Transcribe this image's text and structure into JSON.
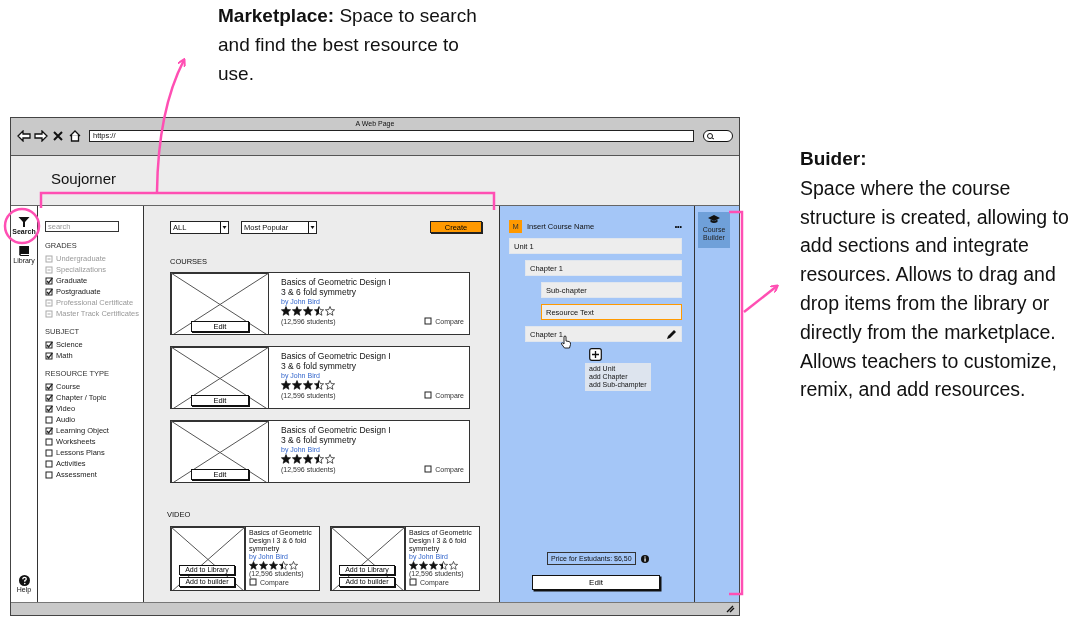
{
  "annotations": {
    "marketplace": {
      "text": "**Marketplace:** Space to search and find the best resource to use."
    },
    "builder": {
      "title": "Buider:",
      "text": "Space where the course structure is created, allowing to add sections and integrate resources. Allows to drag and drop items from the library or directly from the marketplace. Allows teachers to customize, remix, and add resources."
    }
  },
  "browser": {
    "title": "A Web Page",
    "url": "https://"
  },
  "app": {
    "name": "Soujorner"
  },
  "nav": [
    {
      "kind": "filter",
      "label": "Search",
      "selected": true
    },
    {
      "kind": "book",
      "label": "Library",
      "selected": false
    }
  ],
  "help": {
    "label": "Help"
  },
  "filters": {
    "placeholder": "search",
    "groups": [
      {
        "title": "GRADES",
        "items": [
          {
            "label": "Undergraduate",
            "checked": false,
            "disabled": true
          },
          {
            "label": "Specializations",
            "checked": false,
            "disabled": true
          },
          {
            "label": "Graduate",
            "checked": true,
            "disabled": false
          },
          {
            "label": "Postgraduate",
            "checked": true,
            "disabled": false
          },
          {
            "label": "Professional Certificate",
            "checked": false,
            "disabled": true
          },
          {
            "label": "Master Track Certificates",
            "checked": false,
            "disabled": true
          }
        ]
      },
      {
        "title": "SUBJECT",
        "items": [
          {
            "label": "Science",
            "checked": true,
            "disabled": false
          },
          {
            "label": "Math",
            "checked": true,
            "disabled": false
          }
        ]
      },
      {
        "title": "RESOURCE TYPE",
        "items": [
          {
            "label": "Course",
            "checked": true,
            "disabled": false
          },
          {
            "label": "Chapter / Topic",
            "checked": true,
            "disabled": false
          },
          {
            "label": "Video",
            "checked": true,
            "disabled": false
          },
          {
            "label": "Audio",
            "checked": false,
            "disabled": false
          },
          {
            "label": "Learning Object",
            "checked": true,
            "disabled": false
          },
          {
            "label": "Worksheets",
            "checked": false,
            "disabled": false
          },
          {
            "label": "Lessons Plans",
            "checked": false,
            "disabled": false
          },
          {
            "label": "Activities",
            "checked": false,
            "disabled": false
          },
          {
            "label": "Assessment",
            "checked": false,
            "disabled": false
          }
        ]
      }
    ]
  },
  "toolbar": {
    "dropdowns": [
      "ALL",
      "Most Popular"
    ],
    "create": "Create"
  },
  "courses": {
    "heading": "COURSES",
    "items": [
      {
        "title": "Basics of Geometric Design I",
        "subtitle": "3 & 6 fold symmetry",
        "author": "by John Bird",
        "stars": 3.5,
        "students": "(12,596 students)",
        "compare": "Compare",
        "checked": false,
        "edit": "Edit"
      },
      {
        "title": "Basics of Geometric Design I",
        "subtitle": "3 & 6 fold symmetry",
        "author": "by John Bird",
        "stars": 3.5,
        "students": "(12,596 students)",
        "compare": "Compare",
        "checked": false,
        "edit": "Edit"
      },
      {
        "title": "Basics of Geometric Design I",
        "subtitle": "3 & 6 fold symmetry",
        "author": "by John Bird",
        "stars": 3.5,
        "students": "(12,596 students)",
        "compare": "Compare",
        "checked": false,
        "edit": "Edit"
      }
    ]
  },
  "videos": {
    "heading": "VIDEO",
    "items": [
      {
        "title": "Basics of Geometric Design I 3 & 6 fold symmetry",
        "author": "by John Bird",
        "stars": 3.5,
        "students": "(12,596 students)",
        "compare": "Compare",
        "checked": false,
        "buttons": [
          "Add to Library",
          "Add to builder"
        ]
      },
      {
        "title": "Basics of Geometric Design I 3 & 6 fold symmetry",
        "author": "by John Bird",
        "stars": 3.5,
        "students": "(12,596 students)",
        "compare": "Compare",
        "checked": false,
        "buttons": [
          "Add to Library",
          "Add to builder"
        ]
      }
    ]
  },
  "builder": {
    "badge": "M",
    "course_name": "Insert Course Name",
    "more": "•••",
    "tree": [
      {
        "label": "Unit 1",
        "selected": false,
        "hovered": false,
        "children": [
          {
            "label": "Chapter 1",
            "selected": false,
            "hovered": false,
            "children": [
              {
                "label": "Sub-chapter",
                "selected": false,
                "hovered": false
              },
              {
                "label": "Resource Text",
                "selected": true,
                "hovered": false
              }
            ]
          },
          {
            "label": "Chapter 1",
            "selected": false,
            "hovered": true
          }
        ]
      }
    ],
    "add_menu": [
      "add Unit",
      "add Chapter",
      "add Sub-champter"
    ],
    "price": "Price for Estudants: $6,50",
    "edit": "Edit"
  },
  "right_nav": [
    {
      "label": "Course Builder",
      "selected": true
    }
  ]
}
